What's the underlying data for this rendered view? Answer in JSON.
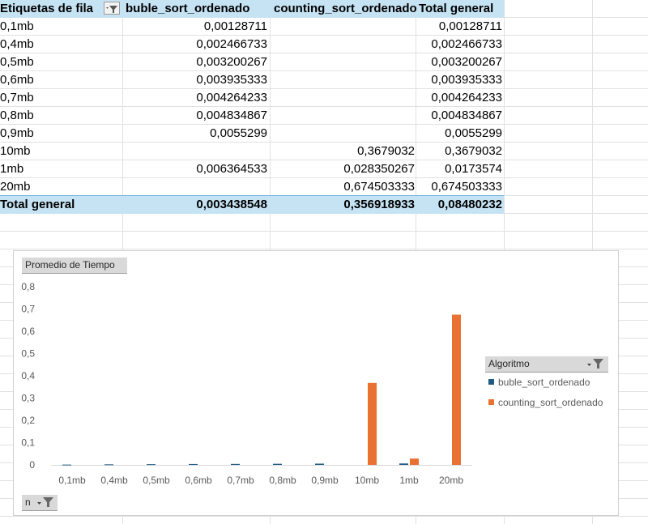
{
  "pivot": {
    "header": {
      "row_labels": "Etiquetas de fila",
      "col1": "buble_sort_ordenado",
      "col2": "counting_sort_ordenado",
      "col3": "Total general"
    },
    "rows": [
      {
        "label": "0,1mb",
        "c1": "0,00128711",
        "c2": "",
        "c3": "0,00128711"
      },
      {
        "label": "0,4mb",
        "c1": "0,002466733",
        "c2": "",
        "c3": "0,002466733"
      },
      {
        "label": "0,5mb",
        "c1": "0,003200267",
        "c2": "",
        "c3": "0,003200267"
      },
      {
        "label": "0,6mb",
        "c1": "0,003935333",
        "c2": "",
        "c3": "0,003935333"
      },
      {
        "label": "0,7mb",
        "c1": "0,004264233",
        "c2": "",
        "c3": "0,004264233"
      },
      {
        "label": "0,8mb",
        "c1": "0,004834867",
        "c2": "",
        "c3": "0,004834867"
      },
      {
        "label": "0,9mb",
        "c1": "0,0055299",
        "c2": "",
        "c3": "0,0055299"
      },
      {
        "label": "10mb",
        "c1": "",
        "c2": "0,3679032",
        "c3": "0,3679032"
      },
      {
        "label": "1mb",
        "c1": "0,006364533",
        "c2": "0,028350267",
        "c3": "0,0173574"
      },
      {
        "label": "20mb",
        "c1": "",
        "c2": "0,674503333",
        "c3": "0,674503333"
      }
    ],
    "total": {
      "label": "Total general",
      "c1": "0,003438548",
      "c2": "0,356918933",
      "c3": "0,08480232"
    }
  },
  "chart": {
    "value_field_button": "Promedio de Tiempo",
    "legend_field_button": "Algoritmo",
    "axis_field_button": "n",
    "colors": {
      "buble_sort_ordenado": "#1f5b84",
      "counting_sort_ordenado": "#e97132"
    }
  },
  "chart_data": {
    "type": "bar",
    "categories": [
      "0,1mb",
      "0,4mb",
      "0,5mb",
      "0,6mb",
      "0,7mb",
      "0,8mb",
      "0,9mb",
      "10mb",
      "1mb",
      "20mb"
    ],
    "series": [
      {
        "name": "buble_sort_ordenado",
        "values": [
          0.00128711,
          0.002466733,
          0.003200267,
          0.003935333,
          0.004264233,
          0.004834867,
          0.0055299,
          null,
          0.006364533,
          null
        ]
      },
      {
        "name": "counting_sort_ordenado",
        "values": [
          null,
          null,
          null,
          null,
          null,
          null,
          null,
          0.3679032,
          0.028350267,
          0.674503333
        ]
      }
    ],
    "ylim": [
      0,
      0.8
    ],
    "yticks": [
      "0",
      "0,1",
      "0,2",
      "0,3",
      "0,4",
      "0,5",
      "0,6",
      "0,7",
      "0,8"
    ],
    "grid": false,
    "legend": "right"
  }
}
